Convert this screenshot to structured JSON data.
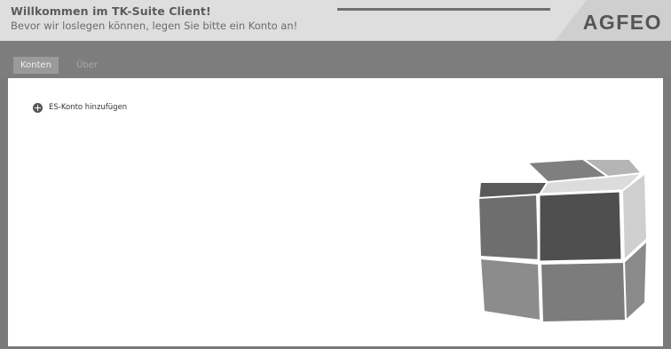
{
  "header": {
    "title": "Willkommen im TK-Suite Client!",
    "subtitle": "Bevor wir loslegen können, legen Sie bitte ein Konto an!",
    "logo": "AGFEO"
  },
  "tabs": [
    {
      "label": "Konten",
      "active": true
    },
    {
      "label": "Über",
      "active": false
    }
  ],
  "content": {
    "add_account": {
      "label": "ES-Konto hinzufügen",
      "icon": "plus-circle-icon"
    },
    "illustration": "cube-icon"
  },
  "colors": {
    "header_bg": "#dedede",
    "tabbar_bg": "#7d7d7d",
    "active_tab_bg": "#9a9a9a",
    "content_bg": "#ffffff"
  }
}
